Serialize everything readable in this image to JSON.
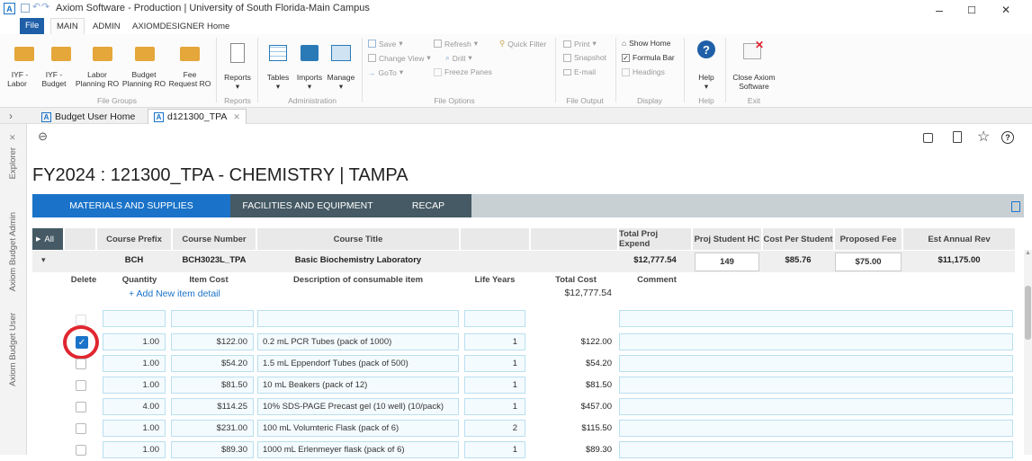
{
  "window": {
    "title": "Axiom Software - Production | University of South Florida-Main Campus",
    "minimize": "–",
    "maximize": "☐",
    "close": "✕"
  },
  "menu": {
    "file": "File",
    "items": [
      "MAIN",
      "ADMIN",
      "AXIOMDESIGNER",
      "Home"
    ]
  },
  "ribbon": {
    "iyf_labor": [
      "IYF -",
      "Labor"
    ],
    "iyf_budget": [
      "IYF -",
      "Budget"
    ],
    "labor_planning": [
      "Labor",
      "Planning RO"
    ],
    "budget_planning": [
      "Budget",
      "Planning RO"
    ],
    "fee_request": [
      "Fee",
      "Request RO"
    ],
    "file_groups": "File Groups",
    "reports": "Reports",
    "reports_group": "Reports",
    "tables": "Tables",
    "imports": "Imports",
    "manage": "Manage",
    "administration": "Administration",
    "save": "Save",
    "change_view": "Change View",
    "goto": "GoTo",
    "refresh": "Refresh",
    "drill": "Drill",
    "freeze": "Freeze Panes",
    "quick_filter": "Quick Filter",
    "file_options": "File Options",
    "print": "Print",
    "snapshot": "Snapshot",
    "email": "E-mail",
    "file_output": "File Output",
    "show_home": "Show Home",
    "formula_bar": "Formula Bar",
    "headings": "Headings",
    "display": "Display",
    "help": "Help",
    "help_group": "Help",
    "close_axiom": [
      "Close Axiom",
      "Software"
    ],
    "exit": "Exit"
  },
  "doc_tabs": {
    "chev": "›",
    "home": "Budget User Home",
    "current": "d121300_TPA",
    "close": "✕"
  },
  "rail": {
    "explorer": "Explorer",
    "admin": "Axiom Budget Admin",
    "user": "Axiom Budget User",
    "x": "✕"
  },
  "page_title": "FY2024 : 121300_TPA - CHEMISTRY | TAMPA",
  "sheet_tabs": [
    "MATERIALS AND SUPPLIES",
    "FACILITIES AND EQUIPMENT",
    "RECAP"
  ],
  "summary": {
    "headers": [
      "All",
      "Course Prefix",
      "Course Number",
      "Course Title",
      "",
      "",
      "Total Proj Expend",
      "Proj Student HC",
      "Cost Per Student",
      "Proposed Fee",
      "Est Annual Rev"
    ],
    "row": {
      "prefix": "BCH",
      "number": "BCH3023L_TPA",
      "title": "Basic Biochemistry Laboratory",
      "total": "$12,777.54",
      "hc": "149",
      "cost_per": "$85.76",
      "fee": "$75.00",
      "rev": "$11,175.00"
    }
  },
  "detail": {
    "headers": [
      "Delete",
      "Quantity",
      "Item Cost",
      "Description of consumable item",
      "Life Years",
      "Total Cost",
      "Comment"
    ],
    "add_link": "+ Add New item detail",
    "grand_total": "$12,777.54",
    "rows": [
      {
        "checked": true,
        "qty": "1.00",
        "cost": "$122.00",
        "desc": "0.2 mL PCR Tubes (pack of 1000)",
        "life": "1",
        "total": "$122.00"
      },
      {
        "checked": false,
        "qty": "1.00",
        "cost": "$54.20",
        "desc": "1.5 mL Eppendorf Tubes (pack of 500)",
        "life": "1",
        "total": "$54.20"
      },
      {
        "checked": false,
        "qty": "1.00",
        "cost": "$81.50",
        "desc": "10 mL Beakers (pack of 12)",
        "life": "1",
        "total": "$81.50"
      },
      {
        "checked": false,
        "qty": "4.00",
        "cost": "$114.25",
        "desc": "10% SDS-PAGE Precast gel (10 well) (10/pack)",
        "life": "1",
        "total": "$457.00"
      },
      {
        "checked": false,
        "qty": "1.00",
        "cost": "$231.00",
        "desc": "100 mL Volumteric Flask (pack of 6)",
        "life": "2",
        "total": "$115.50"
      },
      {
        "checked": false,
        "qty": "1.00",
        "cost": "$89.30",
        "desc": "1000 mL Erlenmeyer flask (pack of 6)",
        "life": "1",
        "total": "$89.30"
      }
    ]
  },
  "colors": {
    "accent": "#1a73c8",
    "tab_dark": "#455a64",
    "highlight": "#e0262f"
  }
}
